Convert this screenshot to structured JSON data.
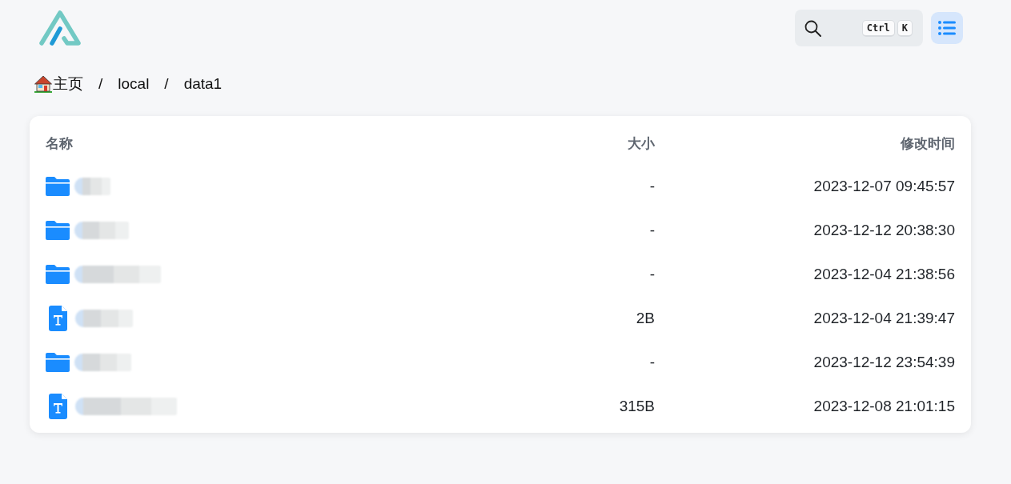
{
  "header": {
    "search": {
      "shortcut_keys": [
        "Ctrl",
        "K"
      ]
    }
  },
  "breadcrumb": [
    {
      "kind": "home",
      "label": "主页"
    },
    {
      "kind": "separator",
      "label": "/"
    },
    {
      "kind": "link",
      "label": "local"
    },
    {
      "kind": "separator",
      "label": "/"
    },
    {
      "kind": "link",
      "label": "data1"
    }
  ],
  "table": {
    "columns": [
      "名称",
      "大小",
      "修改时间"
    ],
    "rows": [
      {
        "kind": "folder",
        "size": "-",
        "modified": "2023-12-07 09:45:57"
      },
      {
        "kind": "folder",
        "size": "-",
        "modified": "2023-12-12 20:38:30"
      },
      {
        "kind": "folder",
        "size": "-",
        "modified": "2023-12-04 21:38:56"
      },
      {
        "kind": "file",
        "size": "2B",
        "modified": "2023-12-04 21:39:47"
      },
      {
        "kind": "folder",
        "size": "-",
        "modified": "2023-12-12 23:54:39"
      },
      {
        "kind": "file",
        "size": "315B",
        "modified": "2023-12-08 21:01:15"
      }
    ]
  }
}
